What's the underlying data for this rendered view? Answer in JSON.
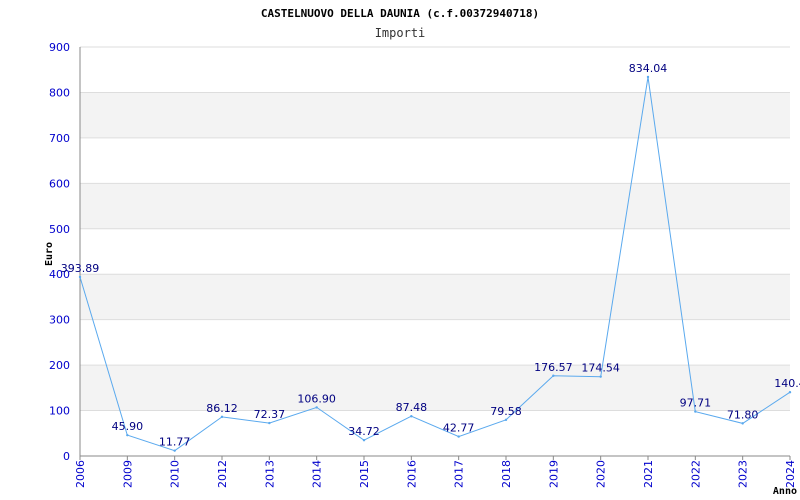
{
  "colors": {
    "background": "#ffffff",
    "band": "#f3f3f3",
    "grid": "#dddddd",
    "axis": "#888888",
    "series": "#5aa9ee",
    "tick_label": "#0000cc",
    "value_label": "#000080",
    "title": "#000000"
  },
  "chart_data": {
    "type": "line",
    "title": "CASTELNUOVO DELLA DAUNIA (c.f.00372940718)",
    "subtitle": "Importi",
    "ylabel": "Euro",
    "xlabel": "Anno",
    "ylim": [
      0,
      900
    ],
    "yticks": [
      0,
      100,
      200,
      300,
      400,
      500,
      600,
      700,
      800,
      900
    ],
    "grid": true,
    "x": [
      "2006",
      "2009",
      "2010",
      "2012",
      "2013",
      "2014",
      "2015",
      "2016",
      "2017",
      "2018",
      "2019",
      "2020",
      "2021",
      "2022",
      "2023",
      "2024"
    ],
    "values": [
      393.89,
      45.9,
      11.77,
      86.12,
      72.37,
      106.9,
      34.72,
      87.48,
      42.77,
      79.58,
      176.57,
      174.54,
      834.04,
      97.71,
      71.8,
      140.4
    ],
    "value_labels": [
      "393.89",
      "45.90",
      "11.77",
      "86.12",
      "72.37",
      "106.90",
      "34.72",
      "87.48",
      "42.77",
      "79.58",
      "176.57",
      "174.54",
      "834.04",
      "97.71",
      "71.80",
      "140.4"
    ]
  }
}
